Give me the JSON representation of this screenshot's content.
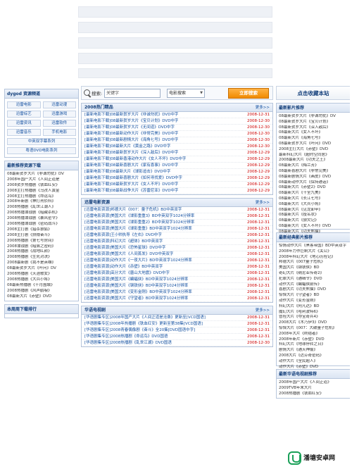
{
  "colors": {
    "accent": "#124fa0",
    "date": "#cc0000",
    "button": "#f08a00"
  },
  "left": {
    "categories_title": "dygod 资源频道",
    "categories": [
      "迅雷电影",
      "迅雷动漫",
      "迅雷综艺",
      "迅雷游戏",
      "迅雷资讯",
      "迅雷软件",
      "迅雷音乐",
      "手机电影",
      "中英双字幕系列",
      "粤语DVD电影系列"
    ],
    "download_title": "最新推荐资源下载",
    "download_items": [
      "08最新贺岁大片《非诚勿扰》DV",
      "2008年国产大片《人间正道是",
      "2008贺岁热播剧《铁血红安》",
      "2008主打热播剧《乌孜人黄金",
      "2008主打热播剧《命运鸟》",
      "2008年新剧《神打刑侦科》",
      "2008热播剧《乱世江湖人》",
      "2008热播谍战剧《暗藏杀机》",
      "2008热播谍战剧《暴风密令》",
      "2008热播谍战剧《密码战斗》",
      "2008主打剧《猎杀狼狐》",
      "2008主打剧《拼搏奋斗》",
      "2008热播剧《第七号房间》",
      "2008谍战剧《暗算之密码》",
      "2008热播剧《战地红颜》",
      "2008热播剧《生死对决》",
      "2008最新剧《我不是英雄》",
      "08最新贺岁大片《叶问》DV",
      "2008热播剧《天涯歌女》",
      "2008热播剧《大兵小将》",
      "08最新热播剧《十月围城》",
      "2008热播剧《风声鹤唳》",
      "08最新大片《赤壁》DVD"
    ],
    "next_title": "本周周下载排行"
  },
  "search": {
    "label": "搜索:",
    "placeholder": "关键字",
    "select": "电影搜索",
    "button": "立即搜索"
  },
  "panel1": {
    "title": "2008热门精品",
    "more": "更多>>",
    "rows": [
      {
        "t": "[最新电影下载]08最新贺岁大片《非诚勿扰》DVD中字",
        "d": "2008-12-31"
      },
      {
        "t": "[最新电影下载]08最新贺岁大片《宝贝计划》DVD中字",
        "d": "2008-12-30"
      },
      {
        "t": "[最新电影下载]08最新贺岁大片《无间道》DVD中字",
        "d": "2008-12-30"
      },
      {
        "t": "[最新电影下载]08最新动作大片《非常完美》DVD中字",
        "d": "2008-12-30"
      },
      {
        "t": "[最新电影下载]08最新剧情大片《海角七号》DVD中字",
        "d": "2008-12-30"
      },
      {
        "t": "[最新电影下载]08最新大片《黄金之路》DVD中字",
        "d": "2008-12-30"
      },
      {
        "t": "[最新电影下载]08最新贺岁大片《深入敌后》DVD中字",
        "d": "2008-12-29"
      },
      {
        "t": "[最新电影下载]08最新香港动作大片《女人不坏》DVD中字",
        "d": "2008-12-29"
      },
      {
        "t": "[最新电影下载]08最新喜剧大片《家有喜事》DVD中字",
        "d": "2008-12-29"
      },
      {
        "t": "[最新电影下载]08最新大片《谍影追击》DVD中字",
        "d": "2008-12-29"
      },
      {
        "t": "[最新电影下载]08最新喜剧大片《如何寻找爱》DVD中字",
        "d": "2008-12-29"
      },
      {
        "t": "[最新电影下载]08最新贺岁大片《女人不坏》DVD中字",
        "d": "2008-12-29"
      },
      {
        "t": "[最新电影下载]08最新战争大片《苏雷尼亚》DVD中字",
        "d": "2008-12-29"
      }
    ]
  },
  "panel2": {
    "title": "迅雷电影资源",
    "more": "更多>>",
    "rows": [
      {
        "t": "[迅雷电影资源]邦德大片《007：量子危机》BD中英双字",
        "d": "2008-12-31"
      },
      {
        "t": "[迅雷电影资源]美国大片《谍影重重3》BD中英双字1024分辨率",
        "d": "2008-12-31"
      },
      {
        "t": "[迅雷电影资源]美国大片《谍影重重2》BD中英双字1024分辨率",
        "d": "2008-12-31"
      },
      {
        "t": "[迅雷电影资源]美国大片《谍影重重》BD中英双字1024分辨率",
        "d": "2008-12-31"
      },
      {
        "t": "[迅雷电影资源]王小帅执导《左右》DVD中字",
        "d": "2008-12-31"
      },
      {
        "t": "[迅雷电影资源]科幻大片《超体》BD中英双字",
        "d": "2008-12-31"
      },
      {
        "t": "[迅雷电影资源]美国大片《恐怖星球》DVD中字",
        "d": "2008-12-31"
      },
      {
        "t": "[迅雷电影资源]美国大片《人间蒸发》DVD中英双字",
        "d": "2008-12-31"
      },
      {
        "t": "[迅雷电影资源]动作大片《一夜大片》BD中英双字1024分辨率",
        "d": "2008-12-31"
      },
      {
        "t": "[迅雷电影资源]动作大片《赤壁》BD中英双字",
        "d": "2008-12-31"
      },
      {
        "t": "[迅雷电影资源]高分大片《唐山大地震》DVD中字",
        "d": "2008-12-31"
      },
      {
        "t": "[迅雷电影资源]美国大片《蝙蝠侠》BD中英双字1024分辨率",
        "d": "2008-12-31"
      },
      {
        "t": "[迅雷电影资源]美国大片《钢铁侠》BD中英双字1024分辨率",
        "d": "2008-12-31"
      },
      {
        "t": "[迅雷电影资源]美国大片《变形金刚》BD中英双字1024分辨率",
        "d": "2008-12-31"
      },
      {
        "t": "[迅雷电影资源]美国大片《守望者》BD中英双字1024分辨率",
        "d": "2008-12-31"
      }
    ]
  },
  "panel3": {
    "title": "华语电视剧",
    "more": "更多>>",
    "rows": [
      {
        "t": "[华语剧集专区]2008年国产大片《人间正道是沧桑》更新至[VCD国语]",
        "d": "2008-12-31"
      },
      {
        "t": "[华语剧集专区]2008年热播剧《铁血红安》更新至第38集[VCD国语]",
        "d": "2008-12-31"
      },
      {
        "t": "[华语剧集专区]2008青春偶像剧《奋斗》全20集[DVD国语中字]",
        "d": "2008-12-31"
      },
      {
        "t": "[华语剧集专区]2008热播剧《命运鸟》DVD国语",
        "d": "2008-12-31"
      },
      {
        "t": "[华语剧集专区]2008热播剧《乱世江湖》DVD国语",
        "d": "2008-12-30"
      }
    ]
  },
  "right": {
    "fav": "点击收藏本站",
    "new_title": "最新影片推荐",
    "new_items": [
      "08最新贺岁大片《非诚勿扰》DV",
      "08最新贺岁大片《宝贝计划》",
      "08最新贺岁大片《深入敌后》",
      "08最新大片《女人不坏》",
      "08最新大片《海角七号》",
      "08最新贺岁大片《叶问》DVD",
      "2008主打大片《赤壁》DVD",
      "最新科幻大片《超时空同居》",
      "2008最新大片《功夫之王》",
      "08最新大片《梅兰芳》",
      "08最新喜剧大片《非常完美》",
      "08最新剧情大片《画皮》DVD",
      "08最新动作大片《保持通话》",
      "08最新大片《赤壁2》DVD",
      "08最新大片《十全九美》",
      "08最新大片《长江七号》",
      "08最新大片《大兵小将》",
      "08最新大片《见龙卸甲》",
      "08最新大片《投名状》",
      "08最新大片《狼灾记》",
      "08最新大片《女人不坏》DVD",
      "08最新大片《功夫熊猫》"
    ],
    "classic_title": "最新经典影片推荐",
    "classic_items": [
      "惊情动作大片《黑客帝国》BD中英双字",
      "2008年力作巨制大片《关公》",
      "2008年科幻大片《地心历险记》",
      "邦德大片《007量子危机》",
      "美国大片《钢铁侠》BD",
      "奇幻大片《纳尼亚传奇2》",
      "犯罪大片《通缉令》DVD",
      "动作大片《蝙蝠侠前传》",
      "喜剧大片《功夫熊猫》DVD",
      "惊悚大片《守望者》BD",
      "动作大片《变形金刚》",
      "科幻大片《阿凡达》BD",
      "魔幻大片《哈利波特6》",
      "冒险大片《夺宝奇兵4》",
      "2008大片《木乃伊3》DVD",
      "惊悚大片《007：大破量子危机》",
      "2008年大片《终结者》",
      "2008年新片《赤壁》DVD",
      "科幻大片《地球停转之日》",
      "剧情大片《通天神偷》",
      "2008大片《达芬奇密码》",
      "动作大片《全民超人》",
      "动作大片《赤壁》DVD"
    ],
    "tv_title": "最新华语电视剧推荐",
    "tv_items": [
      "2008年国产大片《人间正道》",
      "2009TVB年末大片",
      "2008热播剧《铁血红安》"
    ]
  },
  "logo": {
    "text": "潘塘安卓网"
  }
}
